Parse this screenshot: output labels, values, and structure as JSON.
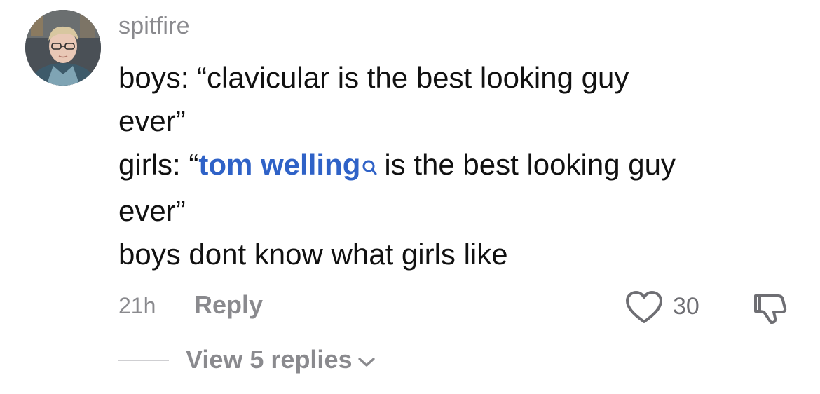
{
  "comment": {
    "username": "spitfire",
    "avatar_icon": "profile-photo",
    "lines": {
      "l1": "boys: “clavicular is the best looking guy",
      "l2": "ever”",
      "l3_prefix": "girls: “",
      "l3_mention": "tom welling",
      "l3_suffix": "is the best looking guy",
      "l4": "ever”",
      "l5": "boys dont know what girls like"
    },
    "mention_color": "#2f62c7",
    "timestamp": "21h",
    "reply_label": "Reply",
    "like_icon": "heart-icon",
    "like_count": "30",
    "dislike_icon": "thumbs-down-icon",
    "view_replies_label": "View 5 replies",
    "view_replies_icon": "chevron-down-icon"
  }
}
